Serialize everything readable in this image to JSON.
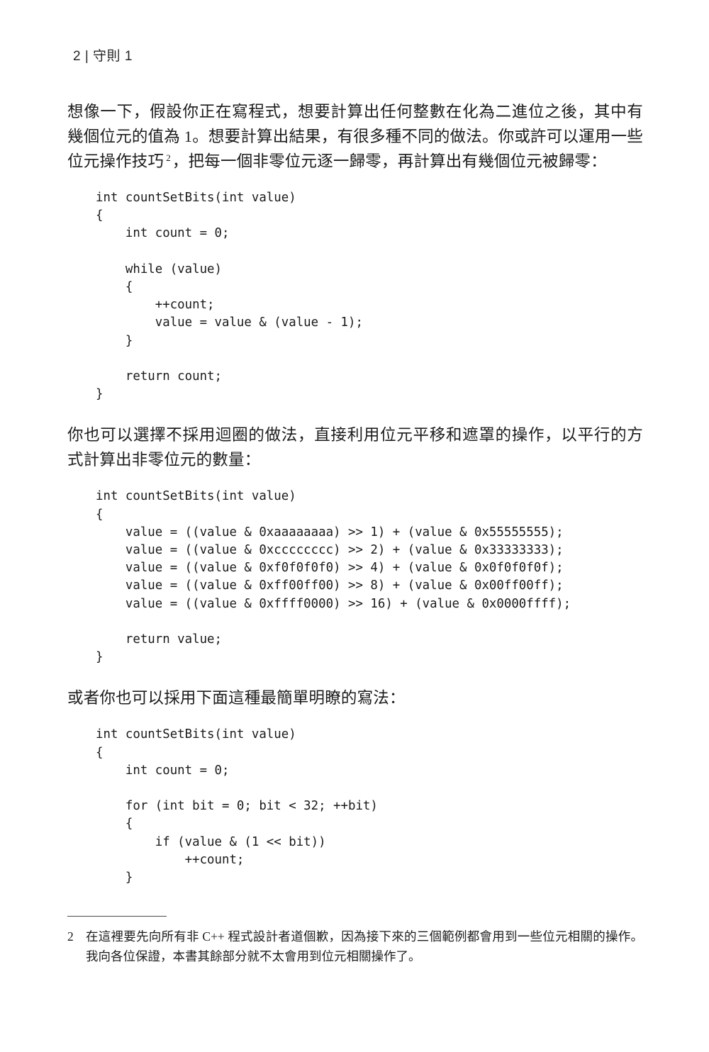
{
  "header": {
    "page_number": "2",
    "separator": "|",
    "chapter_title": "守則 1",
    "full": "2 | 守則 1"
  },
  "body": {
    "paragraph_1": "想像一下，假設你正在寫程式，想要計算出任何整數在化為二進位之後，其中有幾個位元的值為 1。想要計算出結果，有很多種不同的做法。你或許可以運用一些位元操作技巧",
    "paragraph_1_footnote_marker": "2",
    "paragraph_1_cont": "，把每一個非零位元逐一歸零，再計算出有幾個位元被歸零：",
    "paragraph_2": "你也可以選擇不採用迴圈的做法，直接利用位元平移和遮罩的操作，以平行的方式計算出非零位元的數量：",
    "paragraph_3": "或者你也可以採用下面這種最簡單明瞭的寫法："
  },
  "code_blocks": {
    "block_1": "int countSetBits(int value)\n{\n    int count = 0;\n\n    while (value)\n    {\n        ++count;\n        value = value & (value - 1);\n    }\n\n    return count;\n}",
    "block_2": "int countSetBits(int value)\n{\n    value = ((value & 0xaaaaaaaa) >> 1) + (value & 0x55555555);\n    value = ((value & 0xcccccccc) >> 2) + (value & 0x33333333);\n    value = ((value & 0xf0f0f0f0) >> 4) + (value & 0x0f0f0f0f);\n    value = ((value & 0xff00ff00) >> 8) + (value & 0x00ff00ff);\n    value = ((value & 0xffff0000) >> 16) + (value & 0x0000ffff);\n\n    return value;\n}",
    "block_3": "int countSetBits(int value)\n{\n    int count = 0;\n\n    for (int bit = 0; bit < 32; ++bit)\n    {\n        if (value & (1 << bit))\n            ++count;\n    }"
  },
  "footnote": {
    "number": "2",
    "text": "在這裡要先向所有非 C++ 程式設計者道個歉，因為接下來的三個範例都會用到一些位元相關的操作。我向各位保證，本書其餘部分就不太會用到位元相關操作了。"
  }
}
